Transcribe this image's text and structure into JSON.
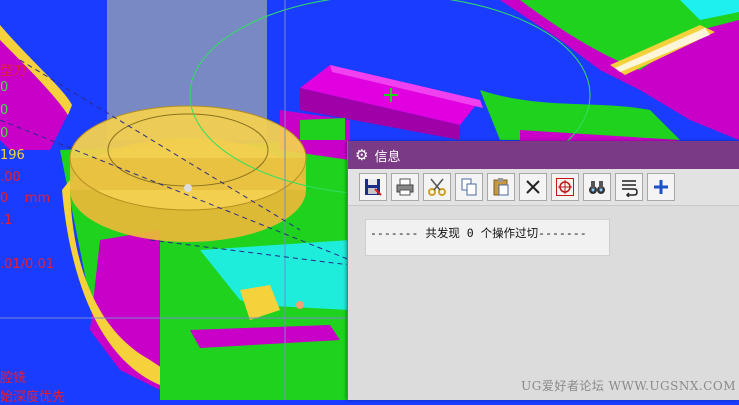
{
  "viewport_labels": {
    "tool_type": "型刀",
    "line1": "0",
    "line2": "0",
    "line3": "0",
    "value_196": "196",
    "value_00": ".00",
    "units": "0    mm",
    "value_1": ".1",
    "tolerance": ".01/0.01",
    "op_name": "腔铣",
    "cut_order": "始深度优先"
  },
  "info_window": {
    "title": "信息",
    "toolbar": [
      {
        "name": "save-button",
        "icon": "floppy-icon"
      },
      {
        "name": "print-button",
        "icon": "printer-icon"
      },
      {
        "name": "cut-button",
        "icon": "scissors-icon"
      },
      {
        "name": "copy-button",
        "icon": "copy-icon"
      },
      {
        "name": "paste-button",
        "icon": "paste-icon"
      },
      {
        "name": "delete-button",
        "icon": "close-icon"
      },
      {
        "name": "target-button",
        "icon": "crosshair-icon"
      },
      {
        "name": "find-button",
        "icon": "binoculars-icon"
      },
      {
        "name": "wrap-button",
        "icon": "wrap-text-icon"
      },
      {
        "name": "add-button",
        "icon": "plus-icon"
      }
    ],
    "message": "------- 共发现 0 个操作过切-------"
  },
  "watermark": "UG爱好者论坛 WWW.UGSNX.COM",
  "colors": {
    "background": "#1a3cff",
    "titlebar": "#7a3a86",
    "magenta": "#c800c8",
    "green": "#1ed21e",
    "yellow": "#f5d23c",
    "cyan": "#1ef0f0"
  }
}
